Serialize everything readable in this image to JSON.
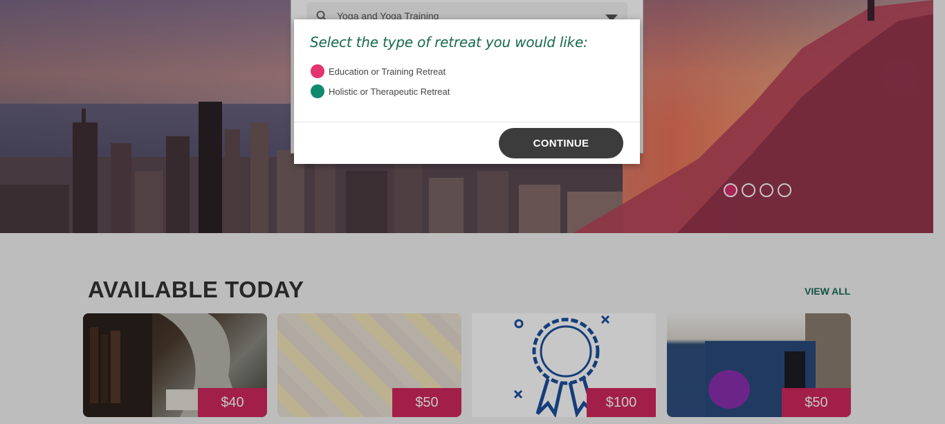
{
  "search": {
    "value": "Yoga and Yoga Training"
  },
  "carousel": {
    "slides": 4,
    "active_index": 0
  },
  "section": {
    "title": "AVAILABLE TODAY",
    "view_all_label": "VIEW ALL"
  },
  "cards": [
    {
      "price": "$40"
    },
    {
      "price": "$50"
    },
    {
      "price": "$100"
    },
    {
      "price": "$50"
    }
  ],
  "modal": {
    "title": "Select the type of retreat you would like:",
    "options": [
      {
        "label": "Education or Training Retreat",
        "color": "#e2346f"
      },
      {
        "label": "Holistic or Therapeutic Retreat",
        "color": "#0f8a6e"
      }
    ],
    "continue_label": "CONTINUE"
  },
  "colors": {
    "accent": "#d0285f",
    "brand_green": "#17684f",
    "button_dark": "#3c3c3c"
  }
}
